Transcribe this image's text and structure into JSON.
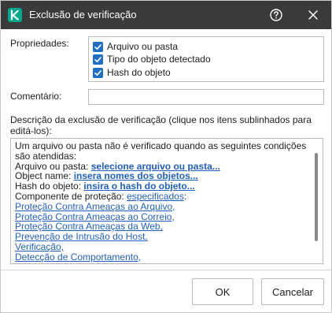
{
  "window": {
    "title": "Exclusão de verificação",
    "accent_color": "#00a88e",
    "title_bar_color": "#3a3a3a",
    "icons": [
      "app-logo-icon",
      "help-icon",
      "close-icon"
    ]
  },
  "properties": {
    "label": "Propriedades:",
    "items": [
      {
        "label": "Arquivo ou pasta",
        "checked": true
      },
      {
        "label": "Tipo do objeto detectado",
        "checked": true
      },
      {
        "label": "Hash do objeto",
        "checked": true
      }
    ]
  },
  "comment": {
    "label": "Comentário:",
    "value": "",
    "placeholder": ""
  },
  "description": {
    "label": "Descrição da exclusão de verificação (clique nos itens sublinhados para editá-los):",
    "intro_line1": "Um arquivo ou pasta não é verificado quando as seguintes condições",
    "intro_line2": "são atendidas:",
    "file_prefix": "Arquivo ou pasta: ",
    "file_link": "selecione arquivo ou pasta...",
    "object_prefix": "Object name: ",
    "object_link": "insera nomes dos objetos...",
    "hash_prefix": "Hash do objeto: ",
    "hash_link": "insira o hash do objeto...",
    "component_prefix": "Componente de proteção: ",
    "component_link": "especificados",
    "component_suffix": ":",
    "components": [
      "Proteção Contra Ameaças ao Arquivo,",
      "Proteção Contra Ameaças ao Correio,",
      "Proteção Contra Ameaças da Web,",
      "Prevenção de Intrusão do Host,",
      "Verificação,",
      "Detecção de Comportamento,"
    ]
  },
  "buttons": {
    "ok": "OK",
    "cancel": "Cancelar"
  }
}
